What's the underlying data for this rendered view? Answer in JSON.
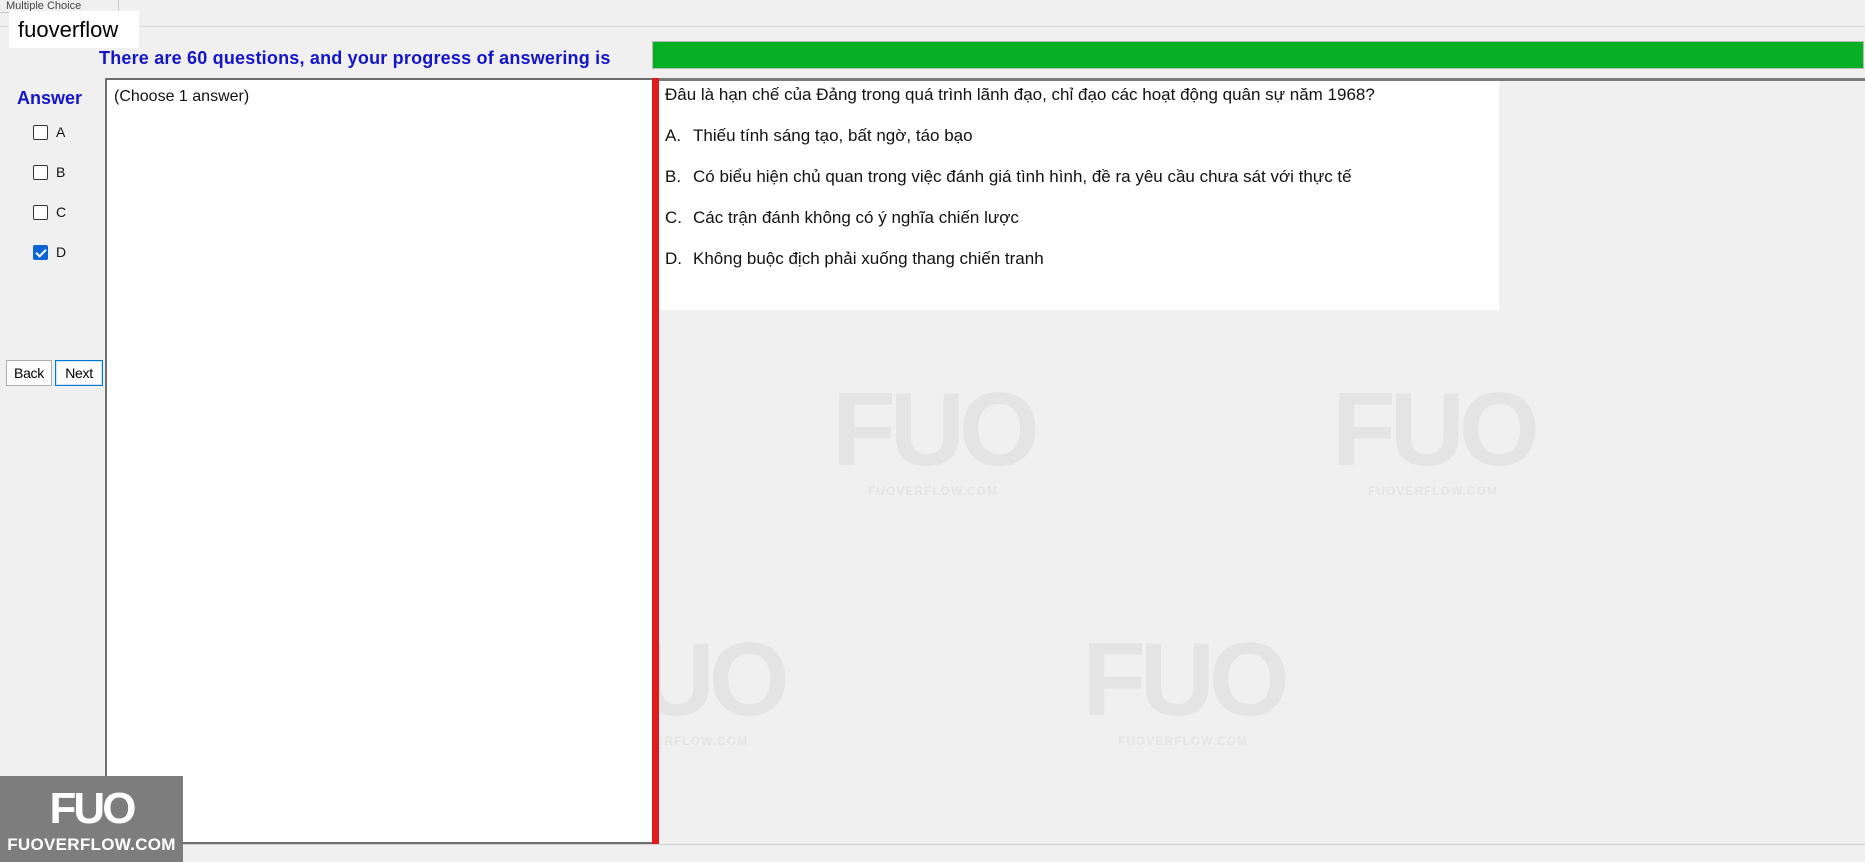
{
  "window": {
    "tab_title": "Multiple Choice"
  },
  "site_label": "fuoverflow",
  "progress": {
    "text": "There are 60 questions, and your progress of answering is",
    "percent": 100,
    "fill_color": "#06b025"
  },
  "answer": {
    "title": "Answer",
    "options": [
      {
        "label": "A",
        "checked": false
      },
      {
        "label": "B",
        "checked": false
      },
      {
        "label": "C",
        "checked": false
      },
      {
        "label": "D",
        "checked": true
      }
    ]
  },
  "nav": {
    "back_label": "Back",
    "next_label": "Next"
  },
  "answer_panel": {
    "hint": "(Choose 1 answer)"
  },
  "question": {
    "text": "Đâu là hạn chế của Đảng trong quá trình lãnh đạo, chỉ đạo các hoạt động quân sự năm 1968?",
    "options": [
      {
        "letter": "A.",
        "text": "Thiếu tính sáng tạo, bất ngờ, táo bạo"
      },
      {
        "letter": "B.",
        "text": "Có biểu hiện chủ quan trong việc đánh giá tình hình, đề ra yêu cầu chưa sát với thực tế"
      },
      {
        "letter": "C.",
        "text": "Các trận đánh không có ý nghĩa chiến lược"
      },
      {
        "letter": "D.",
        "text": "Không buộc địch phải xuống thang chiến tranh"
      }
    ]
  },
  "watermark": {
    "logo": "FUO",
    "site": "FUOVERFLOW.COM"
  },
  "logo": {
    "mark": "FUO",
    "site": "FUOVERFLOW.COM"
  },
  "colors": {
    "accent_text": "#1515c8",
    "splitter": "#e21a1a",
    "checkbox_checked": "#0a64d8"
  }
}
